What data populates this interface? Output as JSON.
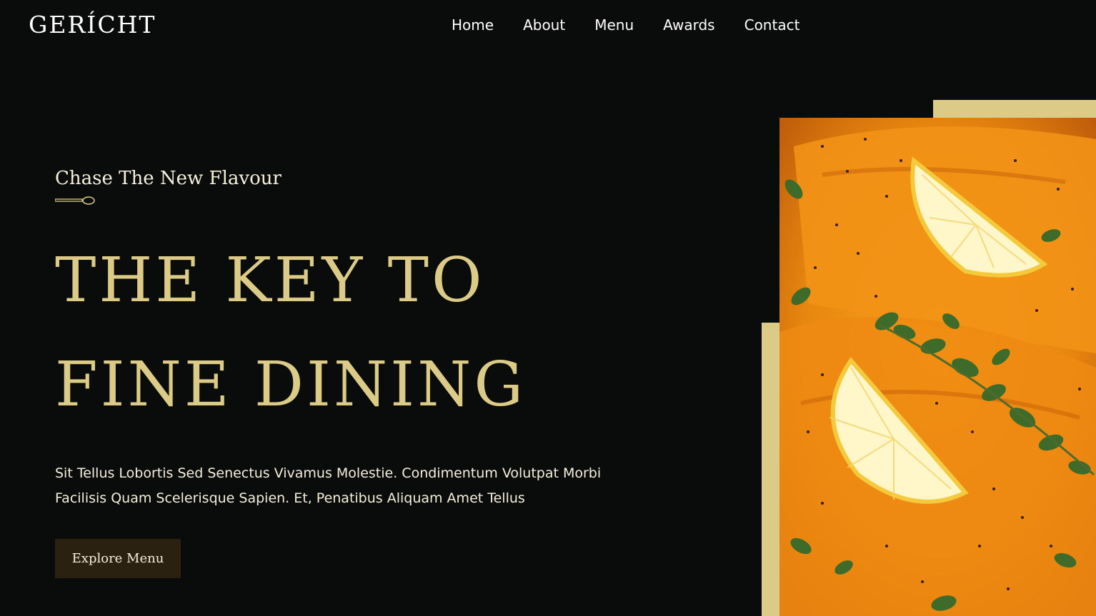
{
  "brand": {
    "logo_text": "GERÍCHT"
  },
  "nav": {
    "items": [
      {
        "label": "Home"
      },
      {
        "label": "About"
      },
      {
        "label": "Menu"
      },
      {
        "label": "Awards"
      },
      {
        "label": "Contact"
      }
    ]
  },
  "hero": {
    "subtitle": "Chase The New Flavour",
    "headline_line1": "THE KEY TO",
    "headline_line2": "FINE DINING",
    "description": "Sit Tellus Lobortis Sed Senectus Vivamus Molestie. Condimentum Volutpat Morbi Facilisis Quam Scelerisque Sapien. Et, Penatibus Aliquam Amet Tellus",
    "cta_label": "Explore Menu"
  },
  "icons": {
    "divider": "spoon-icon"
  },
  "colors": {
    "background": "#0a0b0b",
    "accent_gold": "#dcca87",
    "text_light": "#f5efdb",
    "button_bg": "#2b2111"
  }
}
